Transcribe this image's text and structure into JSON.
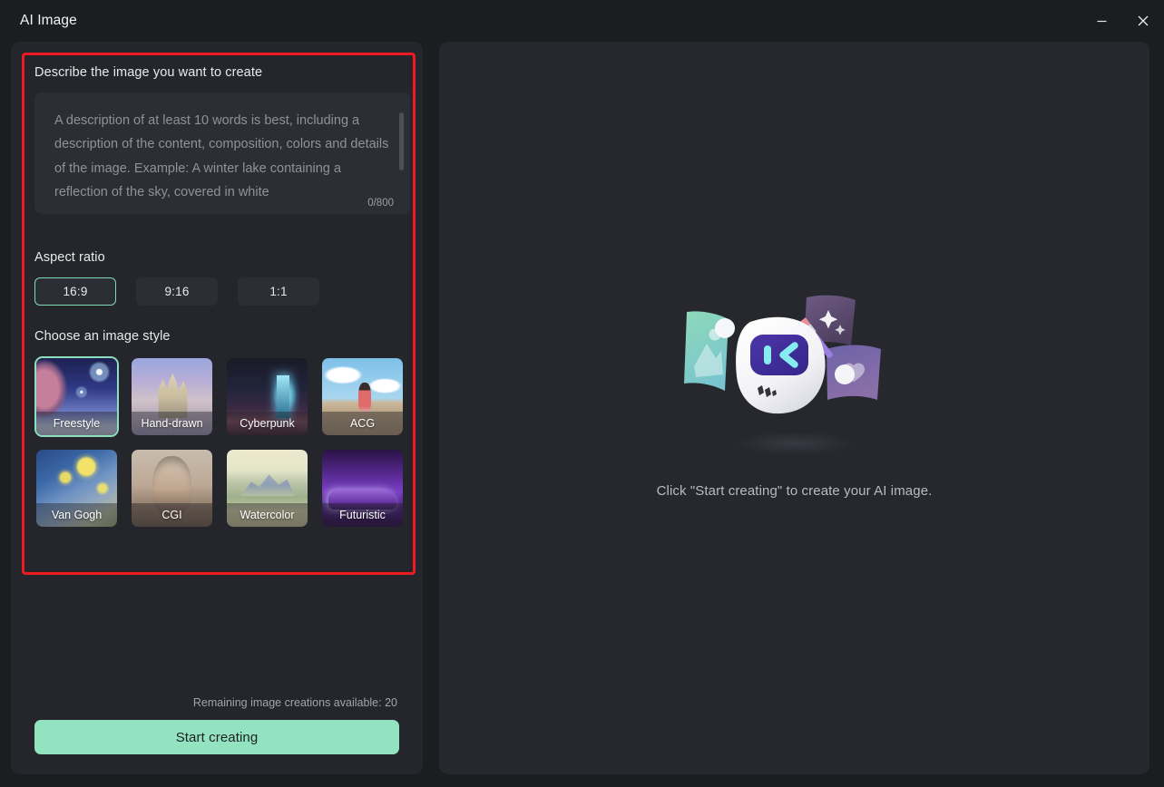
{
  "window": {
    "title": "AI Image",
    "controls": [
      {
        "name": "minimize",
        "icon": "minimize-icon"
      },
      {
        "name": "close",
        "icon": "close-icon"
      }
    ]
  },
  "left_panel": {
    "prompt_section": {
      "label": "Describe the image you want to create",
      "placeholder": "A description of at least 10 words is best, including a description of the content, composition, colors and details of the image. Example: A winter lake containing a reflection of the sky, covered in white",
      "value": "",
      "char_count": "0/800",
      "max_chars": 800
    },
    "aspect_ratio": {
      "label": "Aspect ratio",
      "selected": "16:9",
      "options": [
        {
          "label": "16:9",
          "selected": true
        },
        {
          "label": "9:16",
          "selected": false
        },
        {
          "label": "1:1",
          "selected": false
        }
      ]
    },
    "image_style": {
      "label": "Choose an image style",
      "selected": "Freestyle",
      "options": [
        {
          "label": "Freestyle",
          "selected": true,
          "thumb": "th-freestyle"
        },
        {
          "label": "Hand-drawn",
          "selected": false,
          "thumb": "th-hand"
        },
        {
          "label": "Cyberpunk",
          "selected": false,
          "thumb": "th-cyber"
        },
        {
          "label": "ACG",
          "selected": false,
          "thumb": "th-acg"
        },
        {
          "label": "Van Gogh",
          "selected": false,
          "thumb": "th-vangogh"
        },
        {
          "label": "CGI",
          "selected": false,
          "thumb": "th-cgi"
        },
        {
          "label": "Watercolor",
          "selected": false,
          "thumb": "th-water"
        },
        {
          "label": "Futuristic",
          "selected": false,
          "thumb": "th-future"
        }
      ]
    },
    "footer": {
      "remaining_text": "Remaining image creations available: 20",
      "remaining_count": 20,
      "start_button": "Start creating"
    }
  },
  "right_panel": {
    "empty_message": "Click \"Start creating\" to create your AI image.",
    "illustration": "ai-robot-illustration"
  },
  "annotation": {
    "type": "red-highlight-box",
    "color": "#ee1b20"
  },
  "colors": {
    "window_bg": "#1b1d21",
    "panel_bg": "#24262b",
    "right_panel_bg": "#26282d",
    "input_bg": "#2b2e34",
    "accent_green": "#93e3c0",
    "selection_border": "#8edfbd",
    "annotation_red": "#ee1b20",
    "text_primary": "#e9eaec",
    "text_muted": "#8e9399"
  }
}
